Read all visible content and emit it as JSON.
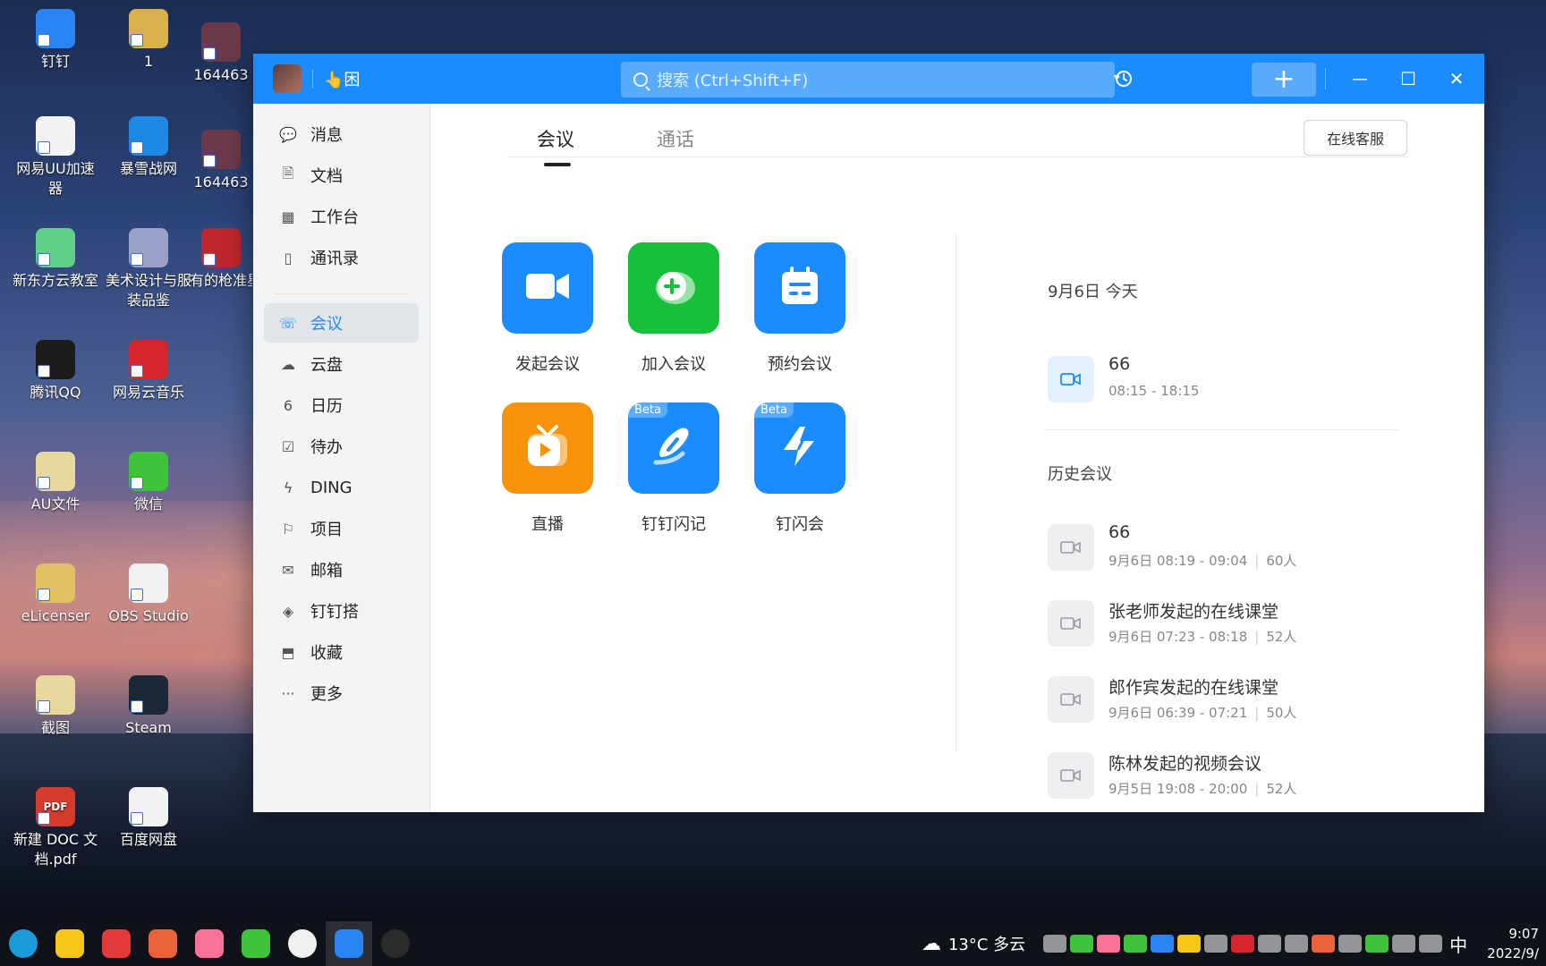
{
  "desktop": {
    "icons": [
      {
        "label": "钉钉",
        "color": "#2a84f5"
      },
      {
        "label": "1",
        "color": "#d9b04a"
      },
      {
        "label": "164463",
        "color": "#6a3a4a"
      },
      {
        "label": "网易UU加速器",
        "color": "#f2f2f2"
      },
      {
        "label": "暴雪战网",
        "color": "#1e88e5"
      },
      {
        "label": "164463",
        "color": "#6a3a4a"
      },
      {
        "label": "新东方云教室",
        "color": "#5fcf8a"
      },
      {
        "label": "美术设计与服装品鉴",
        "color": "#9aa0c8"
      },
      {
        "label": "有的枪准星是",
        "color": "#c0262d"
      },
      {
        "label": "腾讯QQ",
        "color": "#1b1b1b"
      },
      {
        "label": "网易云音乐",
        "color": "#d6262d"
      },
      {
        "label": "AU文件",
        "color": "#e8d8a0"
      },
      {
        "label": "微信",
        "color": "#3fc33a"
      },
      {
        "label": "eLicenser",
        "color": "#e0c060"
      },
      {
        "label": "OBS Studio",
        "color": "#f2f2f2"
      },
      {
        "label": "截图",
        "color": "#e8d8a0"
      },
      {
        "label": "Steam",
        "color": "#1b2838"
      },
      {
        "label": "新建 DOC 文档.pdf",
        "color": "#d63a2a"
      },
      {
        "label": "百度网盘",
        "color": "#f2f2f2"
      }
    ],
    "pdf_badge": "PDF"
  },
  "window": {
    "status_text": "👆困",
    "search_placeholder": "搜索 (Ctrl+Shift+F)",
    "plus_label": "+",
    "minimize_label": "—",
    "maximize_label": "☐",
    "close_label": "✕"
  },
  "sidebar": {
    "items": [
      {
        "label": "消息",
        "icon": "💬"
      },
      {
        "label": "文档",
        "icon": "🗎"
      },
      {
        "label": "工作台",
        "icon": "▦"
      },
      {
        "label": "通讯录",
        "icon": "▯"
      },
      {
        "label": "会议",
        "icon": "☏"
      },
      {
        "label": "云盘",
        "icon": "☁"
      },
      {
        "label": "日历",
        "icon": "6"
      },
      {
        "label": "待办",
        "icon": "☑"
      },
      {
        "label": "DING",
        "icon": "ϟ"
      },
      {
        "label": "项目",
        "icon": "⚐"
      },
      {
        "label": "邮箱",
        "icon": "✉"
      },
      {
        "label": "钉钉搭",
        "icon": "◈"
      },
      {
        "label": "收藏",
        "icon": "⬒"
      },
      {
        "label": "更多",
        "icon": "···"
      }
    ]
  },
  "main": {
    "tabs": [
      {
        "label": "会议"
      },
      {
        "label": "通话"
      }
    ],
    "service_label": "在线客服",
    "actions": [
      {
        "label": "发起会议",
        "color": "#1a8cfd"
      },
      {
        "label": "加入会议",
        "color": "#17c03b"
      },
      {
        "label": "预约会议",
        "color": "#1a8cfd"
      },
      {
        "label": "直播",
        "color": "#f79209"
      },
      {
        "label": "钉钉闪记",
        "color": "#1a8cfd",
        "badge": "Beta"
      },
      {
        "label": "钉闪会",
        "color": "#1a8cfd",
        "badge": "Beta"
      }
    ],
    "today_title": "9月6日 今天",
    "today_meetings": [
      {
        "title": "66",
        "time": "08:15 - 18:15"
      }
    ],
    "history_title": "历史会议",
    "history": [
      {
        "title": "66",
        "time": "9月6日 08:19 - 09:04",
        "people": "60人"
      },
      {
        "title": "张老师发起的在线课堂",
        "time": "9月6日 07:23 - 08:18",
        "people": "52人"
      },
      {
        "title": "郎作宾发起的在线课堂",
        "time": "9月6日 06:39 - 07:21",
        "people": "50人"
      },
      {
        "title": "陈林发起的视频会议",
        "time": "9月5日 19:08 - 20:00",
        "people": "52人"
      }
    ]
  },
  "taskbar": {
    "apps": [
      {
        "name": "edge",
        "color": "#1d9bd8"
      },
      {
        "name": "app-yellow",
        "color": "#f6c619"
      },
      {
        "name": "app-red",
        "color": "#e43a3a"
      },
      {
        "name": "app-orange",
        "color": "#e8623a"
      },
      {
        "name": "bilibili",
        "color": "#fb7299"
      },
      {
        "name": "wechat",
        "color": "#3fc33a"
      },
      {
        "name": "baseball",
        "color": "#f0f0f0"
      },
      {
        "name": "dingtalk",
        "color": "#2a84f5"
      },
      {
        "name": "obs",
        "color": "#2b2b2b"
      }
    ],
    "weather": "13°C 多云",
    "ime": "中",
    "time": "9:07",
    "date": "2022/9/"
  }
}
